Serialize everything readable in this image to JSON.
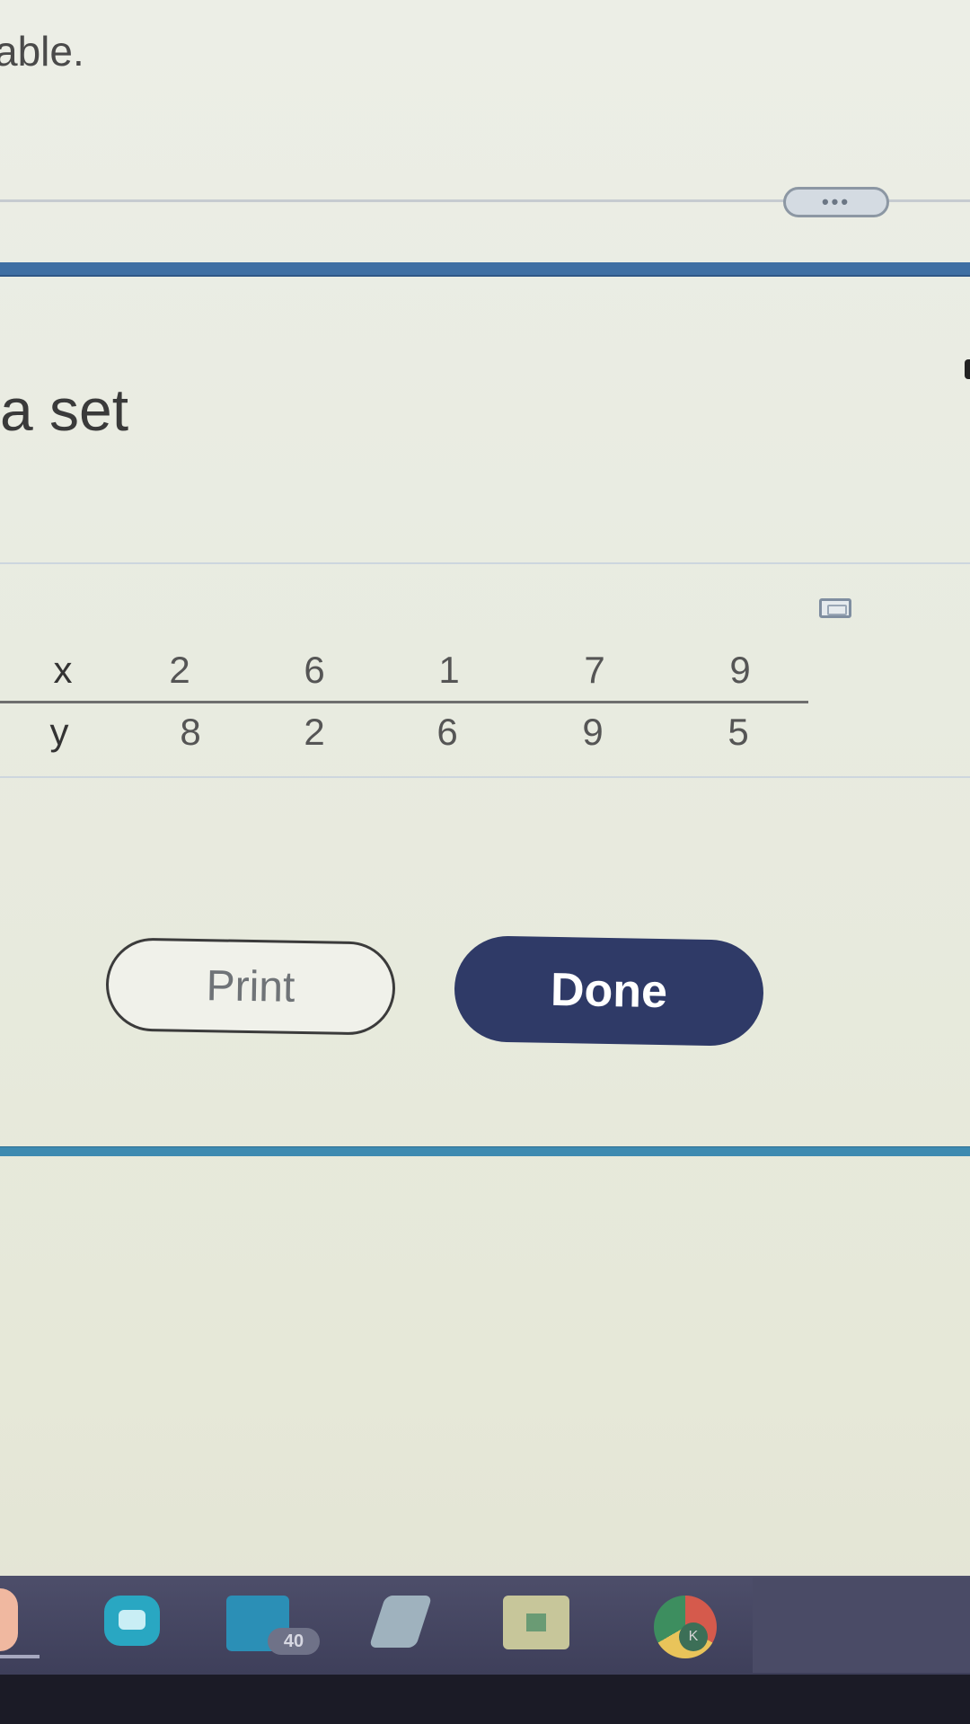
{
  "header": {
    "partial_text": "able.",
    "more_button_label": "•••"
  },
  "dialog": {
    "partial_heading": "a set"
  },
  "table": {
    "rows": [
      {
        "label": "x",
        "values": [
          "2",
          "6",
          "1",
          "7",
          "9"
        ]
      },
      {
        "label": "y",
        "values": [
          "8",
          "2",
          "6",
          "9",
          "5"
        ]
      }
    ]
  },
  "buttons": {
    "print": "Print",
    "done": "Done"
  },
  "taskbar": {
    "calendar_badge": "40",
    "chrome_badge": "K"
  },
  "colors": {
    "done_button": "#2f3a67",
    "header_bar": "#3f6fa3",
    "footer_bar": "#3d8ab0",
    "taskbar": "#45465f"
  }
}
